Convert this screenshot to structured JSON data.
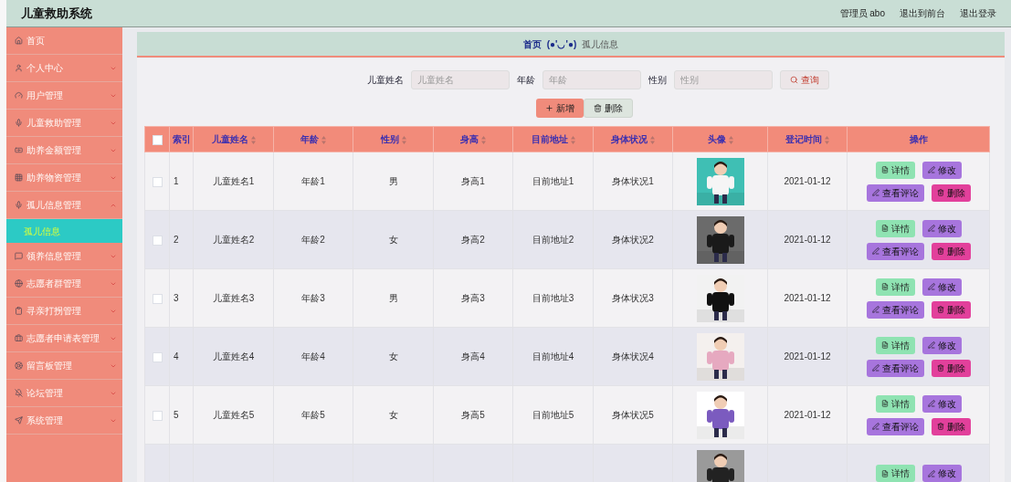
{
  "header": {
    "title": "儿童救助系统",
    "links": [
      "管理员 abo",
      "退出到前台",
      "退出登录"
    ]
  },
  "sidebar": {
    "items": [
      {
        "label": "首页",
        "kind": "link"
      },
      {
        "label": "个人中心",
        "kind": "menu",
        "expanded": false
      },
      {
        "label": "用户管理",
        "kind": "menu",
        "expanded": false
      },
      {
        "label": "儿童救助管理",
        "kind": "menu",
        "expanded": false
      },
      {
        "label": "助养金额管理",
        "kind": "menu",
        "expanded": false
      },
      {
        "label": "助养物资管理",
        "kind": "menu",
        "expanded": false
      },
      {
        "label": "孤儿信息管理",
        "kind": "menu",
        "expanded": true,
        "children": [
          {
            "label": "孤儿信息",
            "selected": true
          }
        ]
      },
      {
        "label": "领养信息管理",
        "kind": "menu",
        "expanded": false
      },
      {
        "label": "志愿者群管理",
        "kind": "menu",
        "expanded": false
      },
      {
        "label": "寻亲打拐管理",
        "kind": "menu",
        "expanded": false
      },
      {
        "label": "志愿者申请表管理",
        "kind": "menu",
        "expanded": false
      },
      {
        "label": "留言板管理",
        "kind": "menu",
        "expanded": false
      },
      {
        "label": "论坛管理",
        "kind": "menu",
        "expanded": false
      },
      {
        "label": "系统管理",
        "kind": "menu",
        "expanded": false
      }
    ]
  },
  "breadcrumb": {
    "home": "首页",
    "separator": "(●'◡'●)",
    "current": "孤儿信息"
  },
  "search": {
    "fields": [
      {
        "label": "儿童姓名",
        "placeholder": "儿童姓名"
      },
      {
        "label": "年龄",
        "placeholder": "年龄"
      },
      {
        "label": "性别",
        "placeholder": "性别"
      }
    ],
    "button": "查询"
  },
  "toolbar": [
    {
      "label": "新增",
      "kind": "add"
    },
    {
      "label": "删除",
      "kind": "delete"
    }
  ],
  "table": {
    "select_all": {
      "checked": false
    },
    "columns": [
      {
        "label": "索引",
        "sortable": false
      },
      {
        "label": "儿童姓名",
        "sortable": true
      },
      {
        "label": "年龄",
        "sortable": true
      },
      {
        "label": "性别",
        "sortable": true
      },
      {
        "label": "身高",
        "sortable": true
      },
      {
        "label": "目前地址",
        "sortable": true
      },
      {
        "label": "身体状况",
        "sortable": true
      },
      {
        "label": "头像",
        "sortable": true
      },
      {
        "label": "登记时间",
        "sortable": true
      },
      {
        "label": "操作",
        "sortable": false
      }
    ],
    "rows": [
      {
        "checked": false,
        "cells": [
          "1",
          "儿童姓名1",
          "年龄1",
          "男",
          "身高1",
          "目前地址1",
          "身体状况1"
        ],
        "photo": {
          "kind": "picture"
        },
        "date": "2021-01-12",
        "actions": [
          {
            "label": "详情",
            "kind": "detail"
          },
          {
            "label": "修改",
            "kind": "edit"
          },
          {
            "label": "查看评论",
            "kind": "comments"
          },
          {
            "label": "删除",
            "kind": "delete"
          }
        ]
      },
      {
        "checked": false,
        "cells": [
          "2",
          "儿童姓名2",
          "年龄2",
          "女",
          "身高2",
          "目前地址2",
          "身体状况2"
        ],
        "photo": {
          "kind": "picture"
        },
        "date": "2021-01-12",
        "actions": [
          {
            "label": "详情",
            "kind": "detail"
          },
          {
            "label": "修改",
            "kind": "edit"
          },
          {
            "label": "查看评论",
            "kind": "comments"
          },
          {
            "label": "删除",
            "kind": "delete"
          }
        ]
      },
      {
        "checked": false,
        "cells": [
          "3",
          "儿童姓名3",
          "年龄3",
          "男",
          "身高3",
          "目前地址3",
          "身体状况3"
        ],
        "photo": {
          "kind": "picture"
        },
        "date": "2021-01-12",
        "actions": [
          {
            "label": "详情",
            "kind": "detail"
          },
          {
            "label": "修改",
            "kind": "edit"
          },
          {
            "label": "查看评论",
            "kind": "comments"
          },
          {
            "label": "删除",
            "kind": "delete"
          }
        ]
      },
      {
        "checked": false,
        "cells": [
          "4",
          "儿童姓名4",
          "年龄4",
          "女",
          "身高4",
          "目前地址4",
          "身体状况4"
        ],
        "photo": {
          "kind": "picture"
        },
        "date": "2021-01-12",
        "actions": [
          {
            "label": "详情",
            "kind": "detail"
          },
          {
            "label": "修改",
            "kind": "edit"
          },
          {
            "label": "查看评论",
            "kind": "comments"
          },
          {
            "label": "删除",
            "kind": "delete"
          }
        ]
      },
      {
        "checked": false,
        "cells": [
          "5",
          "儿童姓名5",
          "年龄5",
          "女",
          "身高5",
          "目前地址5",
          "身体状况5"
        ],
        "photo": {
          "kind": "picture"
        },
        "date": "2021-01-12",
        "actions": [
          {
            "label": "详情",
            "kind": "detail"
          },
          {
            "label": "修改",
            "kind": "edit"
          },
          {
            "label": "查看评论",
            "kind": "comments"
          },
          {
            "label": "删除",
            "kind": "delete"
          }
        ]
      },
      {
        "photo": {
          "kind": "picture"
        },
        "actions": [
          {
            "label": "详情",
            "kind": "detail"
          },
          {
            "label": "修改",
            "kind": "edit"
          }
        ]
      }
    ]
  }
}
